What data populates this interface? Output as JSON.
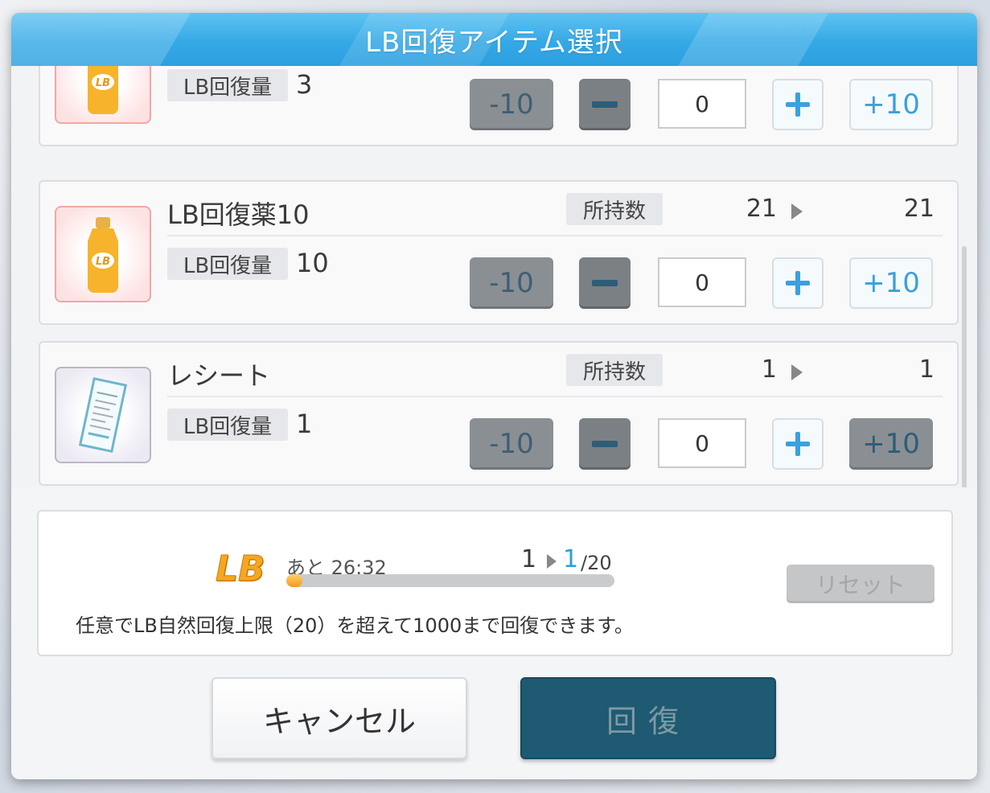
{
  "dialog": {
    "title": "LB回復アイテム選択"
  },
  "items": [
    {
      "name": "",
      "owned_label": "",
      "owned_before": "",
      "owned_after": "",
      "lb_label": "LB回復量",
      "lb_value": "3",
      "minus10_label": "-10",
      "plus10_label": "+10",
      "quantity": "0",
      "icon": "lb-drink-bottle-icon"
    },
    {
      "name": "LB回復薬10",
      "owned_label": "所持数",
      "owned_before": "21",
      "owned_after": "21",
      "lb_label": "LB回復量",
      "lb_value": "10",
      "minus10_label": "-10",
      "plus10_label": "+10",
      "quantity": "0",
      "icon": "lb-drink-bottle-icon"
    },
    {
      "name": "レシート",
      "owned_label": "所持数",
      "owned_before": "1",
      "owned_after": "1",
      "lb_label": "LB回復量",
      "lb_value": "1",
      "minus10_label": "-10",
      "plus10_label": "+10",
      "quantity": "0",
      "icon": "receipt-icon"
    }
  ],
  "status": {
    "logo": "LB",
    "remaining": "あと 26:32",
    "count_before": "1",
    "count_after": "1",
    "count_max": "/20",
    "progress_fraction": 0.05,
    "reset_label": "リセット",
    "info": "任意でLB自然回復上限（20）を超えて1000まで回復できます。"
  },
  "footer": {
    "cancel_label": "キャンセル",
    "recover_label": "回復"
  },
  "colors": {
    "header": "#35a9e6",
    "recover_button": "#1e5a72",
    "accent_blue": "#2a9fe0",
    "lb_orange": "#f5a623"
  }
}
